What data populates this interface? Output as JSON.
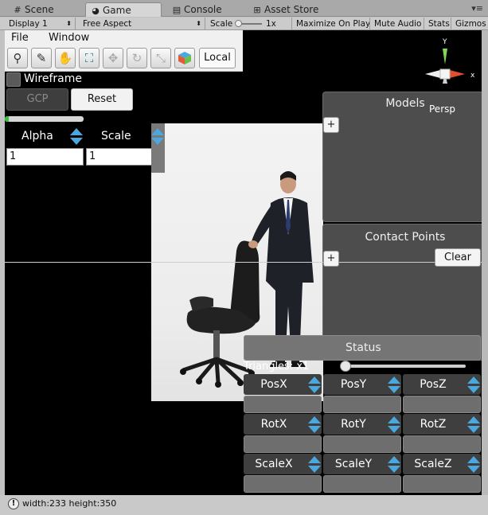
{
  "tabs": [
    {
      "icon": "grid-icon",
      "label": "Scene",
      "glyph": "#"
    },
    {
      "icon": "pacman-icon",
      "label": "Game",
      "glyph": "◕"
    },
    {
      "icon": "console-icon",
      "label": "Console",
      "glyph": "▤"
    },
    {
      "icon": "store-icon",
      "label": "Asset Store",
      "glyph": "⊞"
    }
  ],
  "tab_menu": "▾≡",
  "toolbar": {
    "display": "Display 1",
    "aspect": "Free Aspect",
    "scale_label": "Scale",
    "scale_value": "1x",
    "maximize": "Maximize On Play",
    "mute": "Mute Audio",
    "stats": "Stats",
    "gizmos": "Gizmos"
  },
  "menu": {
    "file": "File",
    "window": "Window"
  },
  "tools": {
    "local": "Local"
  },
  "wireframe_label": "Wireframe",
  "buttons": {
    "gcp": "GCP",
    "reset": "Reset",
    "clear": "Clear",
    "plus": "+"
  },
  "progress": 0.05,
  "fields": {
    "alpha_label": "Alpha",
    "scale_label": "Scale",
    "alpha_value": "1",
    "scale_value": "1"
  },
  "panels": {
    "models": "Models",
    "persp": "Persp",
    "contact_points": "Contact Points",
    "status": "Status",
    "triangles": "Triangles: x1"
  },
  "transform": {
    "row1": [
      "PosX",
      "PosY",
      "PosZ"
    ],
    "row2": [
      "RotX",
      "RotY",
      "RotZ"
    ],
    "row3": [
      "ScaleX",
      "ScaleY",
      "ScaleZ"
    ]
  },
  "gizmo": {
    "y": "Y",
    "x": "x"
  },
  "statusbar": {
    "message": "width:233 height:350"
  },
  "colors": {
    "accent_blue": "#4aa8df",
    "progress_green": "#37c23a"
  }
}
